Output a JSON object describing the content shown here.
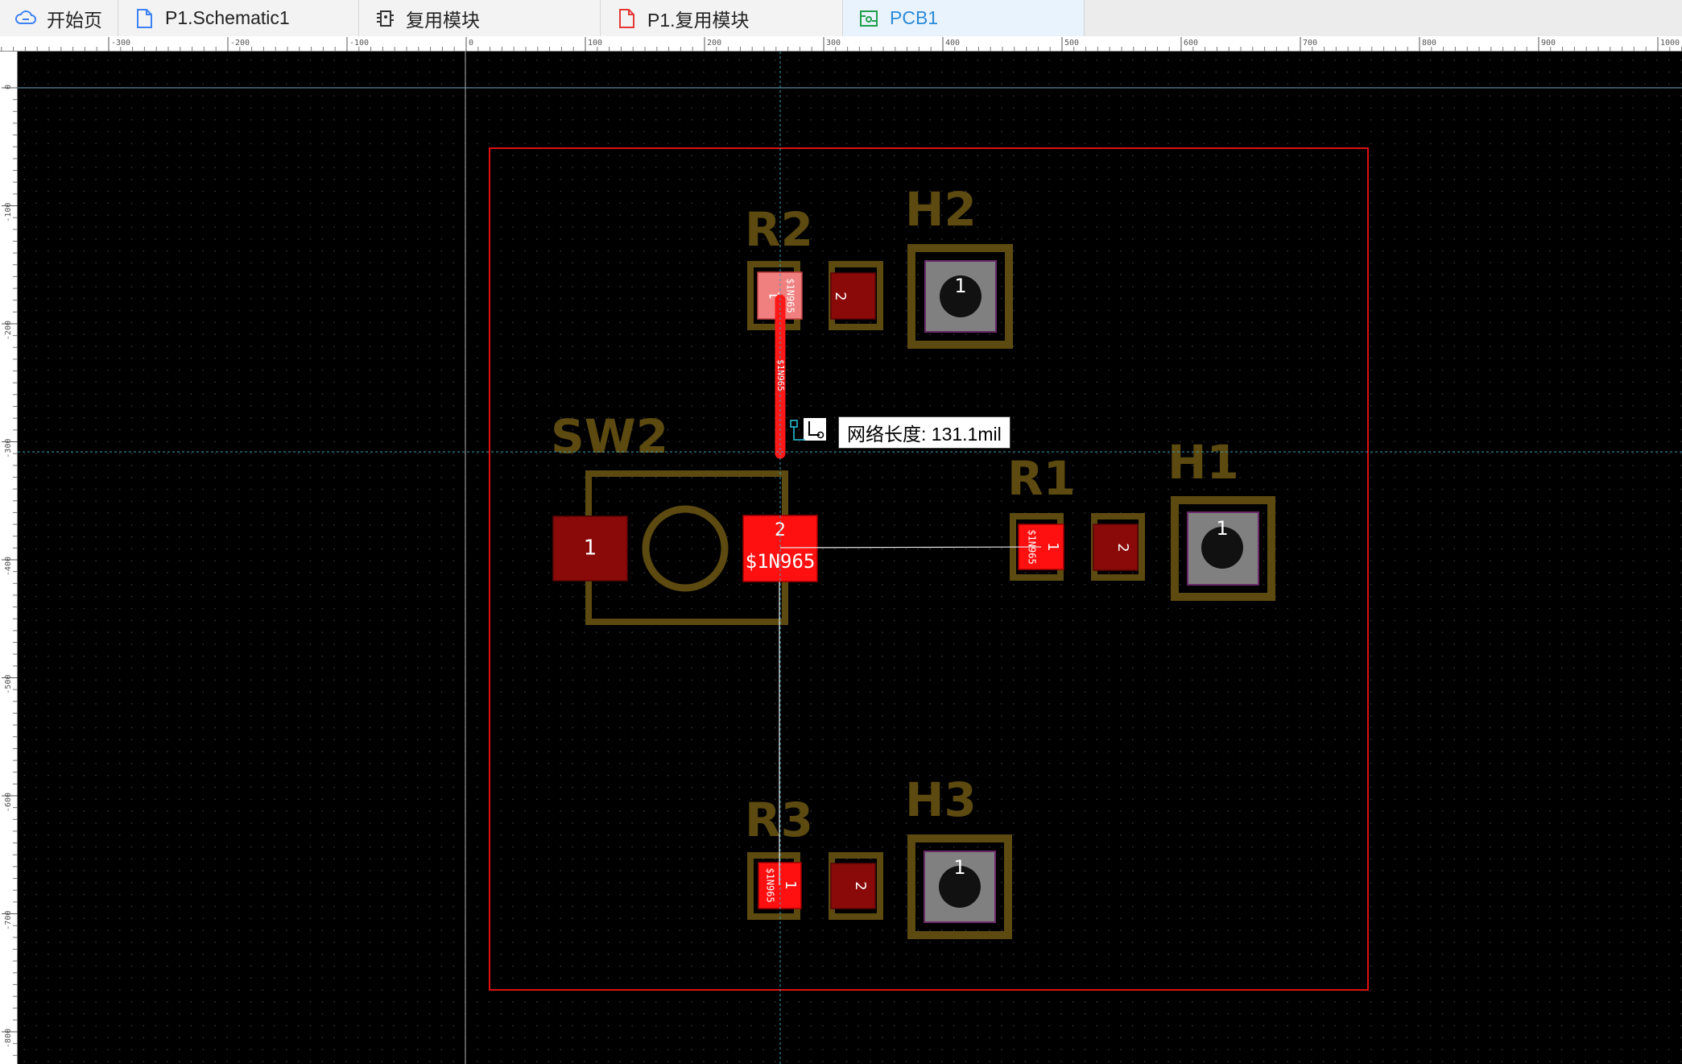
{
  "tabs": [
    {
      "label": "开始页",
      "icon": "cloud-icon",
      "active": false
    },
    {
      "label": "P1.Schematic1",
      "icon": "schematic-file-icon",
      "active": false
    },
    {
      "label": "复用模块",
      "icon": "reuse-module-icon",
      "active": false
    },
    {
      "label": "P1.复用模块",
      "icon": "module-file-icon",
      "active": false
    },
    {
      "label": "PCB1",
      "icon": "pcb-icon",
      "active": true
    }
  ],
  "ruler": {
    "top_ticks": [
      "-300",
      "-200",
      "-100",
      "0",
      "100",
      "200",
      "300",
      "400",
      "500",
      "600",
      "700",
      "800",
      "900",
      "1000"
    ],
    "left_ticks": [
      "0",
      "-100",
      "-200",
      "-300",
      "-400",
      "-500",
      "-600",
      "-700",
      "-800"
    ]
  },
  "colors": {
    "board_bg": "#000000",
    "grid_dot": "#3c3c3c",
    "outline": "#e01010",
    "silkscreen": "#5c4a10",
    "pad_top": "#ff1010",
    "pad_dark": "#8a0a0a",
    "pad_selected": "#f08080",
    "hole": "#808080",
    "crosshair": "#3aa0b8",
    "ratsnest": "#e8e8e8",
    "track": "#ff1818"
  },
  "components": {
    "R2": {
      "designator": "R2",
      "pad1": "1",
      "pad2": "2",
      "pad1_net": "$1N965"
    },
    "H2": {
      "designator": "H2",
      "pad1": "1"
    },
    "SW2": {
      "designator": "SW2",
      "pad1": "1",
      "pad2": "2",
      "pad2_net": "$1N965"
    },
    "R1": {
      "designator": "R1",
      "pad1": "1",
      "pad2": "2",
      "pad1_net": "$1N965"
    },
    "H1": {
      "designator": "H1",
      "pad1": "1"
    },
    "R3": {
      "designator": "R3",
      "pad1": "1",
      "pad2": "2",
      "pad1_net": "$1N965"
    },
    "H3": {
      "designator": "H3",
      "pad1": "1"
    }
  },
  "track": {
    "net": "$1N965"
  },
  "tooltip": {
    "text": "网络长度: 131.1mil"
  }
}
